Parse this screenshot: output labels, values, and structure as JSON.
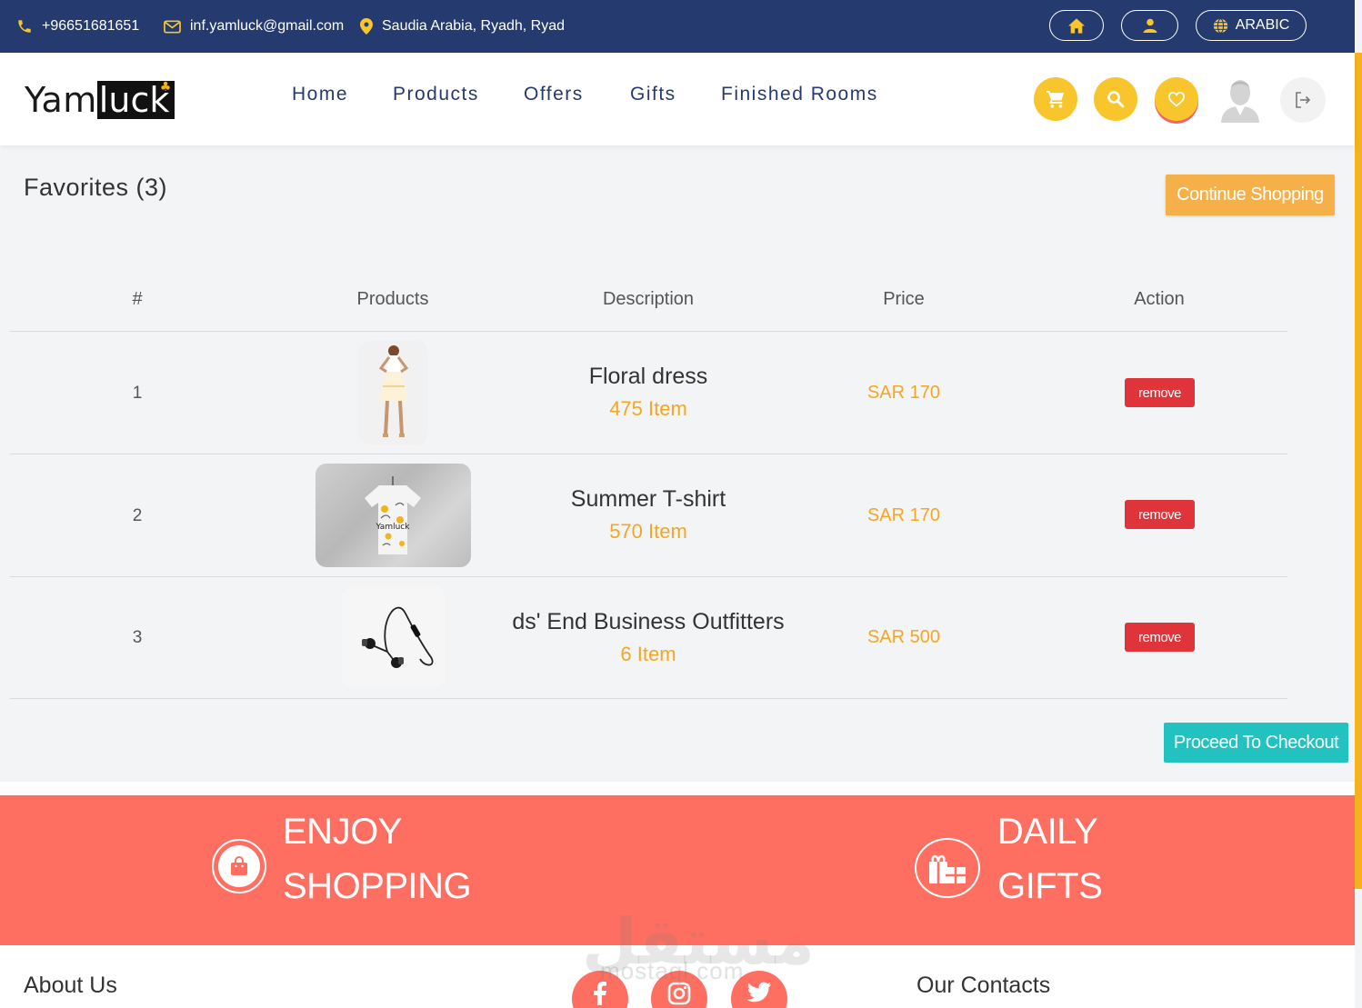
{
  "topbar": {
    "phone": "+96651681651",
    "email": "inf.yamluck@gmail.com",
    "location": "Saudia Arabia, Ryadh, Ryad",
    "language_label": "ARABIC"
  },
  "brand": {
    "logo_part1": "Yam",
    "logo_part2": "luck"
  },
  "nav": {
    "items": [
      {
        "label": "Home"
      },
      {
        "label": "Products"
      },
      {
        "label": "Offers"
      },
      {
        "label": "Gifts"
      },
      {
        "label": "Finished Rooms"
      }
    ]
  },
  "page": {
    "title": "Favorites (3)",
    "continue_label": "Continue Shopping",
    "checkout_label": "Proceed To Checkout"
  },
  "table": {
    "headers": [
      "#",
      "Products",
      "Description",
      "Price",
      "Action"
    ],
    "rows": [
      {
        "num": "1",
        "name": "Floral dress",
        "qty": "475 Item",
        "price": "SAR 170",
        "action": "remove",
        "image": "dress-photo"
      },
      {
        "num": "2",
        "name": "Summer T-shirt",
        "qty": "570 Item",
        "price": "SAR 170",
        "action": "remove",
        "image": "tshirt-photo"
      },
      {
        "num": "3",
        "name": "ds' End Business Outfitters",
        "qty": "6 Item",
        "price": "SAR 500",
        "action": "remove",
        "image": "earphones-photo"
      }
    ]
  },
  "banner": {
    "left_line1": "ENJOY",
    "left_line2": "SHOPPING",
    "right_line1": "DAILY",
    "right_line2": "GIFTS"
  },
  "footer": {
    "about_heading": "About Us",
    "contacts_heading": "Our Contacts",
    "social": [
      "facebook-icon",
      "instagram-icon",
      "twitter-icon"
    ]
  },
  "watermark": {
    "arabic": "مستقل",
    "latin": "mostaql.com"
  },
  "colors": {
    "topbar": "#253a6e",
    "accent_yellow": "#f8c52c",
    "continue_orange": "#f5b04a",
    "price_orange": "#f5a623",
    "remove_red": "#e0343b",
    "checkout_teal": "#22c2c0",
    "banner_coral": "#ff6f61"
  }
}
